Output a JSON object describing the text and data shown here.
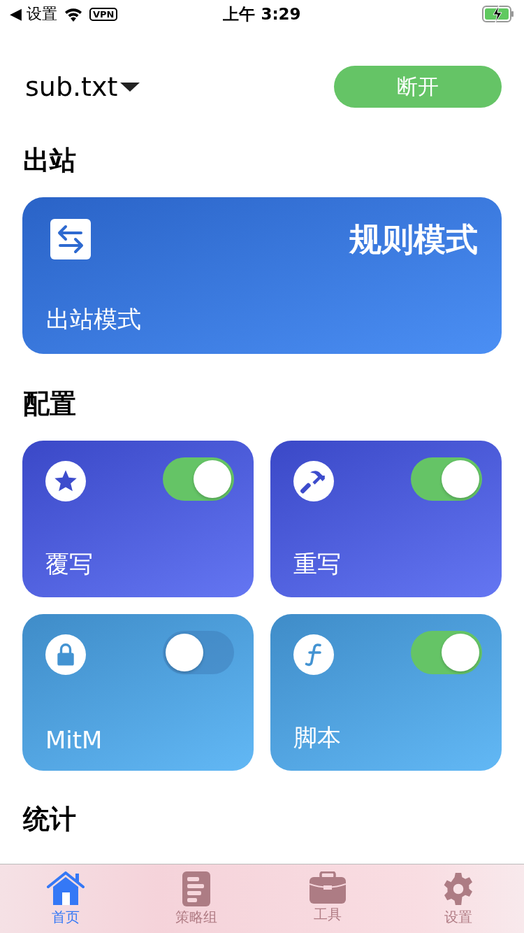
{
  "status_bar": {
    "back": "◀ 设置",
    "vpn": "VPN",
    "time": "上午 3:29"
  },
  "header": {
    "profile": "sub.txt",
    "connect_button": "断开"
  },
  "outbound": {
    "title": "出站",
    "card": {
      "mode": "规则模式",
      "label": "出站模式"
    }
  },
  "config": {
    "title": "配置",
    "cards": [
      {
        "kind": "star",
        "label": "覆写",
        "on": true
      },
      {
        "kind": "hammer",
        "label": "重写",
        "on": true
      },
      {
        "kind": "lock",
        "label": "MitM",
        "on": false
      },
      {
        "kind": "function",
        "label": "脚本",
        "on": true
      }
    ]
  },
  "stats": {
    "title": "统计"
  },
  "tab_bar": [
    {
      "kind": "home",
      "label": "首页",
      "selected": true
    },
    {
      "kind": "list",
      "label": "策略组",
      "selected": false
    },
    {
      "kind": "tools",
      "label": "工具",
      "selected": false
    },
    {
      "kind": "settings",
      "label": "设置",
      "selected": false
    }
  ]
}
